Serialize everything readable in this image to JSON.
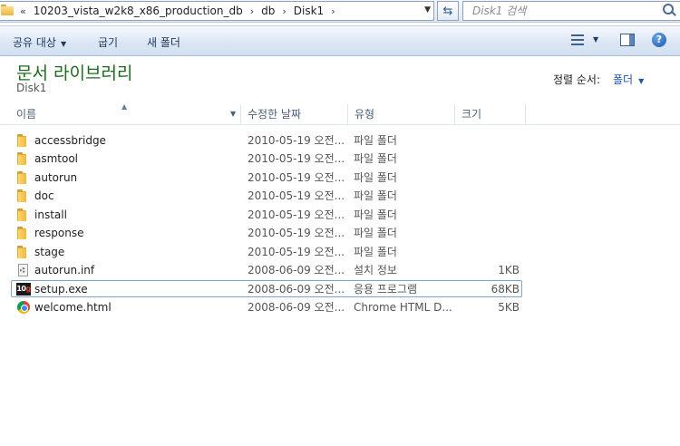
{
  "address_bar": {
    "crumbs": [
      "10203_vista_w2k8_x86_production_db",
      "db",
      "Disk1"
    ]
  },
  "search": {
    "placeholder": "Disk1 검색"
  },
  "toolbar": {
    "share_label": "공유 대상",
    "burn_label": "굽기",
    "new_folder_label": "새 폴더"
  },
  "library": {
    "title": "문서 라이브러리",
    "subtitle": "Disk1",
    "sort_label": "정렬 순서:",
    "sort_value": "폴더"
  },
  "columns": {
    "name": "이름",
    "date": "수정한 날짜",
    "type": "유형",
    "size": "크기"
  },
  "files": [
    {
      "name": "accessbridge",
      "date": "2010-05-19 오전...",
      "type": "파일 폴더",
      "size": "",
      "icon": "folder-icon"
    },
    {
      "name": "asmtool",
      "date": "2010-05-19 오전...",
      "type": "파일 폴더",
      "size": "",
      "icon": "folder-icon"
    },
    {
      "name": "autorun",
      "date": "2010-05-19 오전...",
      "type": "파일 폴더",
      "size": "",
      "icon": "folder-icon"
    },
    {
      "name": "doc",
      "date": "2010-05-19 오전...",
      "type": "파일 폴더",
      "size": "",
      "icon": "folder-icon"
    },
    {
      "name": "install",
      "date": "2010-05-19 오전...",
      "type": "파일 폴더",
      "size": "",
      "icon": "folder-icon"
    },
    {
      "name": "response",
      "date": "2010-05-19 오전...",
      "type": "파일 폴더",
      "size": "",
      "icon": "folder-icon"
    },
    {
      "name": "stage",
      "date": "2010-05-19 오전...",
      "type": "파일 폴더",
      "size": "",
      "icon": "folder-icon"
    },
    {
      "name": "autorun.inf",
      "date": "2008-06-09 오전...",
      "type": "설치 정보",
      "size": "1KB",
      "icon": "config-file-icon"
    },
    {
      "name": "setup.exe",
      "date": "2008-06-09 오전...",
      "type": "응용 프로그램",
      "size": "68KB",
      "icon": "setup-app-icon",
      "selected": true
    },
    {
      "name": "welcome.html",
      "date": "2008-06-09 오전...",
      "type": "Chrome HTML D...",
      "size": "5KB",
      "icon": "chrome-html-icon"
    }
  ],
  "colors": {
    "library_title": "#1d6b1d",
    "sort_value": "#1f56a8",
    "selection_border": "#7da2ce"
  }
}
